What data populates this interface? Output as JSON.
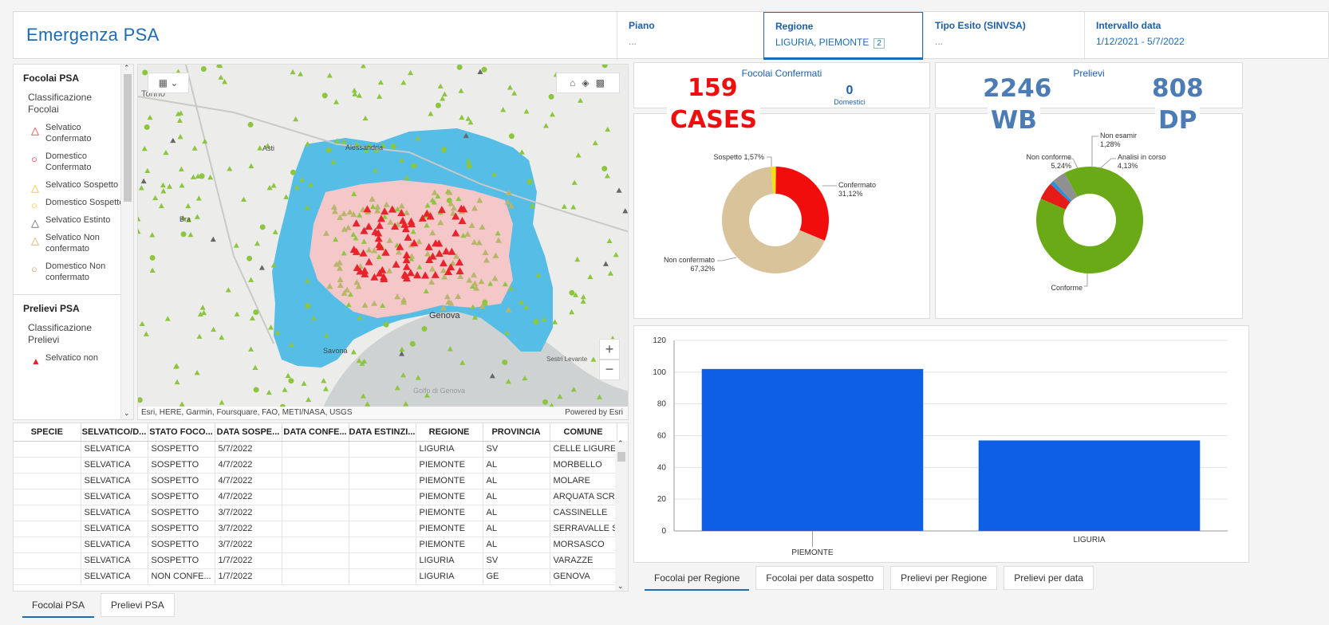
{
  "header": {
    "title": "Emergenza PSA",
    "filters": [
      {
        "label": "Piano",
        "value": "..."
      },
      {
        "label": "Regione",
        "value": "LIGURIA, PIEMONTE",
        "count": "2"
      },
      {
        "label": "Tipo Esito (SINVSA)",
        "value": "..."
      },
      {
        "label": "Intervallo data",
        "value": "1/12/2021 - 5/7/2022"
      }
    ]
  },
  "legend": {
    "focolai_title": "Focolai PSA",
    "focolai_sub": "Classificazione Focolai",
    "items": [
      {
        "label": "Selvatico Confermato",
        "shape": "triangle",
        "color": "#e8232b"
      },
      {
        "label": "Domestico Confermato",
        "shape": "circle",
        "color": "#e8232b"
      },
      {
        "label": "Selvatico Sospetto",
        "shape": "triangle",
        "color": "#f1c21b"
      },
      {
        "label": "Domestico Sospetto",
        "shape": "circle",
        "color": "#f1c21b"
      },
      {
        "label": "Selvatico Estinto",
        "shape": "triangle",
        "color": "#555555"
      },
      {
        "label": "Selvatico Non confermato",
        "shape": "triangle",
        "color": "#e0a05a"
      },
      {
        "label": "Domestico Non confermato",
        "shape": "circle",
        "color": "#e0a05a"
      }
    ],
    "prelievi_title": "Prelievi PSA",
    "prelievi_sub": "Classificazione Prelievi",
    "prelievi_first": "Selvatico non"
  },
  "map": {
    "attribution": "Esri, HERE, Garmin, Foursquare, FAO, METI/NASA, USGS",
    "powered": "Powered by Esri",
    "places": [
      "Torino",
      "Asti",
      "Alessandria",
      "Bra",
      "Savona",
      "Genova",
      "Sestri Levante",
      "Golfo di Genova"
    ]
  },
  "table": {
    "columns": [
      "SPECIE",
      "SELVATICO/D...",
      "STATO FOCO...",
      "DATA SOSPE...",
      "DATA CONFE...",
      "DATA ESTINZI...",
      "REGIONE",
      "PROVINCIA",
      "COMUNE"
    ],
    "rows": [
      [
        "",
        "SELVATICA",
        "SOSPETTO",
        "5/7/2022",
        "",
        "",
        "LIGURIA",
        "SV",
        "CELLE LIGURE"
      ],
      [
        "",
        "SELVATICA",
        "SOSPETTO",
        "4/7/2022",
        "",
        "",
        "PIEMONTE",
        "AL",
        "MORBELLO"
      ],
      [
        "",
        "SELVATICA",
        "SOSPETTO",
        "4/7/2022",
        "",
        "",
        "PIEMONTE",
        "AL",
        "MOLARE"
      ],
      [
        "",
        "SELVATICA",
        "SOSPETTO",
        "4/7/2022",
        "",
        "",
        "PIEMONTE",
        "AL",
        "ARQUATA SCR..."
      ],
      [
        "",
        "SELVATICA",
        "SOSPETTO",
        "3/7/2022",
        "",
        "",
        "PIEMONTE",
        "AL",
        "CASSINELLE"
      ],
      [
        "",
        "SELVATICA",
        "SOSPETTO",
        "3/7/2022",
        "",
        "",
        "PIEMONTE",
        "AL",
        "SERRAVALLE S..."
      ],
      [
        "",
        "SELVATICA",
        "SOSPETTO",
        "3/7/2022",
        "",
        "",
        "PIEMONTE",
        "AL",
        "MORSASCO"
      ],
      [
        "",
        "SELVATICA",
        "SOSPETTO",
        "1/7/2022",
        "",
        "",
        "LIGURIA",
        "SV",
        "VARAZZE"
      ],
      [
        "",
        "SELVATICA",
        "NON CONFE...",
        "1/7/2022",
        "",
        "",
        "LIGURIA",
        "GE",
        "GENOVA"
      ]
    ]
  },
  "tabs_left": [
    "Focolai PSA",
    "Prelievi PSA"
  ],
  "tabs_right": [
    "Focolai per Regione",
    "Focolai per data sospetto",
    "Prelievi per Regione",
    "Prelievi per data"
  ],
  "kpi": {
    "focolai_title": "Focolai Confermati",
    "cases_value": "159",
    "cases_label": "CASES",
    "domestici_value": "0",
    "domestici_label": "Domestici",
    "prelievi_title": "Prelievi",
    "wb_value": "2246",
    "wb_label": "WB",
    "dp_value": "808",
    "dp_label": "DP"
  },
  "chart_data": [
    {
      "type": "pie",
      "title": "Focolai",
      "slices": [
        {
          "label": "Confermato",
          "pct": "31,12%",
          "value": 31.12,
          "color": "#f20d0d"
        },
        {
          "label": "Non confermato",
          "pct": "67,32%",
          "value": 67.32,
          "color": "#d8c39a"
        },
        {
          "label": "Sospetto",
          "pct": "1,57%",
          "value": 1.57,
          "color": "#f2df1a"
        }
      ]
    },
    {
      "type": "pie",
      "title": "Prelievi",
      "slices": [
        {
          "label": "Conforme",
          "pct": "89,36%",
          "value": 89.36,
          "color": "#6aaa16"
        },
        {
          "label": "Non conforme",
          "pct": "5,24%",
          "value": 5.24,
          "color": "#e41b17"
        },
        {
          "label": "Non esamir",
          "pct": "1,28%",
          "value": 1.28,
          "color": "#2f8fd6"
        },
        {
          "label": "Analisi in corso",
          "pct": "4,13%",
          "value": 4.13,
          "color": "#909090"
        }
      ]
    },
    {
      "type": "bar",
      "categories": [
        "PIEMONTE",
        "LIGURIA"
      ],
      "values": [
        102,
        57
      ],
      "ylim": [
        0,
        120
      ],
      "yticks": [
        "0",
        "20",
        "40",
        "60",
        "80",
        "100",
        "120"
      ],
      "color": "#0f5fe6"
    }
  ]
}
